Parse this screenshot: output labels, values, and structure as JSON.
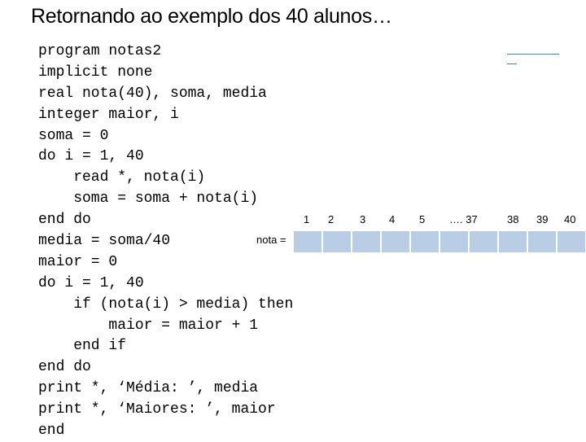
{
  "slide": {
    "title": "Retornando ao exemplo dos 40 alunos…"
  },
  "code": {
    "lines": [
      "program notas2",
      "implicit none",
      "real nota(40), soma, media",
      "integer maior, i",
      "soma = 0",
      "do i = 1, 40",
      "    read *, nota(i)",
      "    soma = soma + nota(i)",
      "end do",
      "media = soma/40",
      "maior = 0",
      "do i = 1, 40",
      "    if (nota(i) > media) then",
      "        maior = maior + 1",
      "    end if",
      "end do",
      "print *, ‘Média: ’, media",
      "print *, ‘Maiores: ’, maior",
      "end"
    ]
  },
  "array_diagram": {
    "label": "nota =",
    "indices": [
      "1",
      "2",
      "3",
      "4",
      "5",
      "…. 37",
      "38",
      "39",
      "40"
    ],
    "cell_count": 10,
    "cell_color": "#b9cde5"
  }
}
